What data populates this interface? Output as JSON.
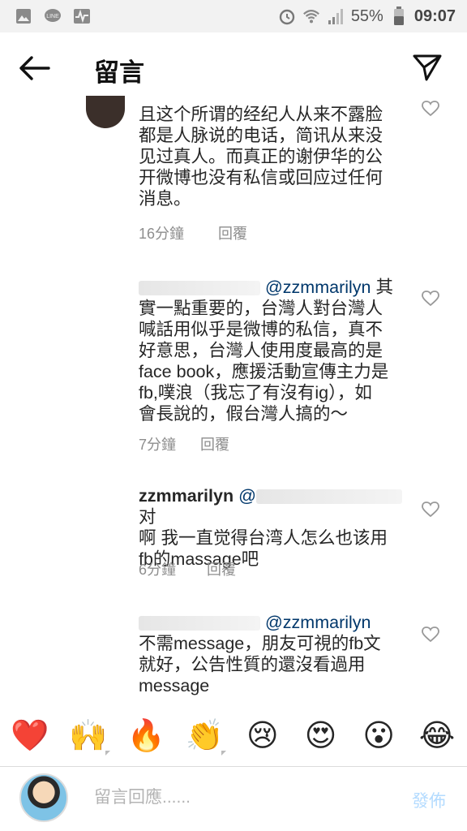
{
  "status_bar": {
    "battery": "55%",
    "time": "09:07",
    "icons": [
      "image-icon",
      "line-icon",
      "pulse-icon",
      "alarm-icon",
      "wifi-icon",
      "signal-icon",
      "battery-icon"
    ]
  },
  "header": {
    "title": "留言",
    "back_icon": "arrow-left-icon",
    "send_icon": "paper-plane-icon"
  },
  "comments": [
    {
      "username": "",
      "mention": "",
      "lines": [
        "且这个所谓的经纪人从来不露脸",
        "都是人脉说的电话，简讯从来没",
        "见过真人。而真正的谢伊华的公",
        "开微博也没有私信或回应过任何",
        "消息。"
      ],
      "time": "16分鐘",
      "reply": "回覆"
    },
    {
      "username": "",
      "mention": "@zzmmarilyn",
      "first_line_tail": "其",
      "lines": [
        "實一點重要的，台灣人對台灣人",
        "喊話用似乎是微博的私信，真不",
        "好意思，台灣人使用度最高的是",
        "face book，應援活動宣傳主力是",
        "fb,噗浪（我忘了有沒有ig），如",
        "會長說的，假台灣人搞的～"
      ],
      "time": "7分鐘",
      "reply": "回覆"
    },
    {
      "username": "zzmmarilyn",
      "mention": "@",
      "first_line_tail": "对",
      "lines": [
        "啊 我一直觉得台湾人怎么也该用",
        "fb的massage吧"
      ],
      "time": "6分鐘",
      "reply": "回覆"
    },
    {
      "username": "",
      "mention": "@zzmmarilyn",
      "lines": [
        "不需message，朋友可視的fb文",
        "就好，公告性質的還沒看過用",
        "message"
      ],
      "time": "",
      "reply": ""
    }
  ],
  "emoji_bar": {
    "emojis": [
      "❤️",
      "🙌",
      "🔥",
      "👏",
      "😢",
      "😍",
      "😮",
      "😂"
    ]
  },
  "composer": {
    "placeholder": "留言回應......",
    "post_label": "發佈"
  },
  "colors": {
    "mention": "#00376b",
    "meta": "#8e8e8e",
    "post_disabled": "#b3dbff"
  }
}
